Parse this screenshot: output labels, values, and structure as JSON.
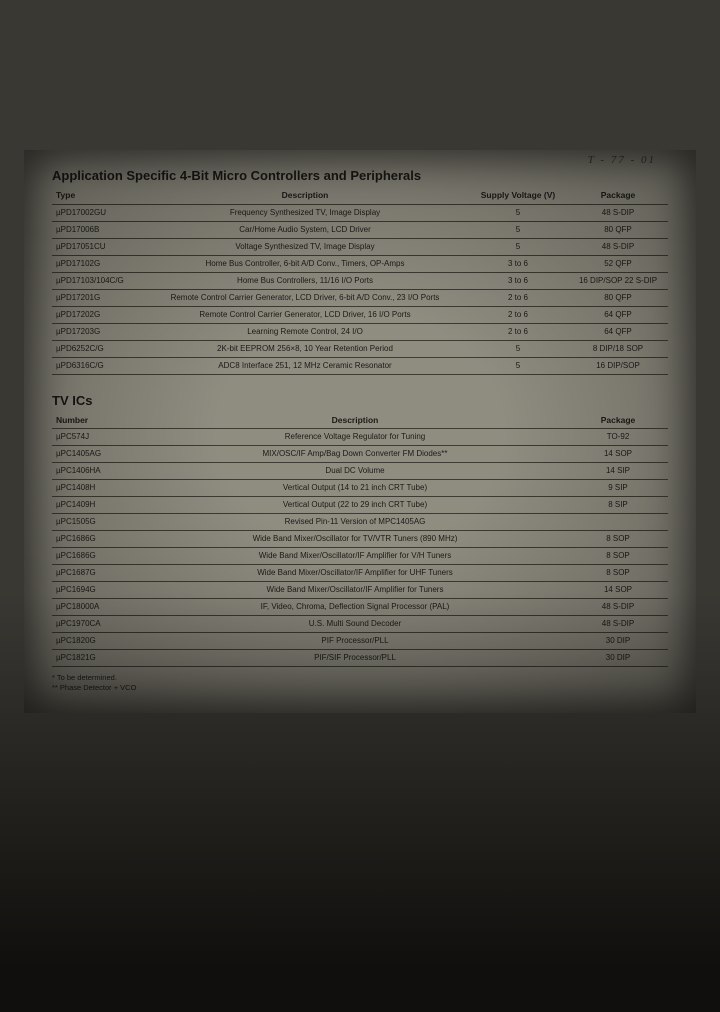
{
  "doc_code": "T - 77 - 01",
  "section1": {
    "title": "Application Specific 4-Bit Micro Controllers and Peripherals",
    "headers": {
      "type": "Type",
      "description": "Description",
      "voltage": "Supply Voltage (V)",
      "package": "Package"
    },
    "rows": [
      {
        "type": "µPD17002GU",
        "desc": "Frequency Synthesized TV, Image Display",
        "volt": "5",
        "pkg": "48 S-DIP"
      },
      {
        "type": "µPD17006B",
        "desc": "Car/Home Audio System, LCD Driver",
        "volt": "5",
        "pkg": "80 QFP"
      },
      {
        "type": "µPD17051CU",
        "desc": "Voltage Synthesized TV, Image Display",
        "volt": "5",
        "pkg": "48 S-DIP"
      },
      {
        "type": "µPD17102G",
        "desc": "Home Bus Controller, 6-bit A/D Conv., Timers, OP-Amps",
        "volt": "3 to 6",
        "pkg": "52 QFP"
      },
      {
        "type": "µPD17103/104C/G",
        "desc": "Home Bus Controllers, 11/16 I/O Ports",
        "volt": "3 to 6",
        "pkg": "16 DIP/SOP\n22 S-DIP"
      },
      {
        "type": "µPD17201G",
        "desc": "Remote Control Carrier Generator, LCD Driver, 6-bit A/D Conv., 23 I/O Ports",
        "volt": "2 to 6",
        "pkg": "80 QFP"
      },
      {
        "type": "µPD17202G",
        "desc": "Remote Control Carrier Generator, LCD Driver, 16 I/O Ports",
        "volt": "2 to 6",
        "pkg": "64 QFP"
      },
      {
        "type": "µPD17203G",
        "desc": "Learning Remote Control, 24 I/O",
        "volt": "2 to 6",
        "pkg": "64 QFP"
      },
      {
        "type": "µPD6252C/G",
        "desc": "2K-bit EEPROM 256×8, 10 Year Retention Period",
        "volt": "5",
        "pkg": "8 DIP/18 SOP"
      },
      {
        "type": "µPD6316C/G",
        "desc": "ADC8 Interface 251, 12 MHz Ceramic Resonator",
        "volt": "5",
        "pkg": "16 DIP/SOP"
      }
    ]
  },
  "section2": {
    "title": "TV ICs",
    "headers": {
      "number": "Number",
      "description": "Description",
      "package": "Package"
    },
    "rows": [
      {
        "num": "µPC574J",
        "desc": "Reference Voltage Regulator for Tuning",
        "pkg": "TO-92"
      },
      {
        "num": "µPC1405AG",
        "desc": "MIX/OSC/IF Amp/Bag Down Converter FM Diodes**",
        "pkg": "14 SOP"
      },
      {
        "num": "µPC1406HA",
        "desc": "Dual DC Volume",
        "pkg": "14 SIP"
      },
      {
        "num": "µPC1408H",
        "desc": "Vertical Output (14 to 21 inch CRT Tube)",
        "pkg": "9 SIP"
      },
      {
        "num": "µPC1409H",
        "desc": "Vertical Output (22 to 29 inch CRT Tube)",
        "pkg": "8 SIP"
      },
      {
        "num": "µPC1505G",
        "desc": "Revised Pin-11 Version of MPC1405AG",
        "pkg": ""
      },
      {
        "num": "µPC1686G",
        "desc": "Wide Band Mixer/Oscillator for TV/VTR Tuners (890 MHz)",
        "pkg": "8 SOP"
      },
      {
        "num": "µPC1686G",
        "desc": "Wide Band Mixer/Oscillator/IF Amplifier for V/H Tuners",
        "pkg": "8 SOP"
      },
      {
        "num": "µPC1687G",
        "desc": "Wide Band Mixer/Oscillator/IF Amplifier for UHF Tuners",
        "pkg": "8 SOP"
      },
      {
        "num": "µPC1694G",
        "desc": "Wide Band Mixer/Oscillator/IF Amplifier for Tuners",
        "pkg": "14 SOP"
      },
      {
        "num": "µPC18000A",
        "desc": "IF, Video, Chroma, Deflection Signal Processor (PAL)",
        "pkg": "48 S-DIP"
      },
      {
        "num": "µPC1970CA",
        "desc": "U.S. Multi Sound Decoder",
        "pkg": "48 S-DIP"
      },
      {
        "num": "µPC1820G",
        "desc": "PIF Processor/PLL",
        "pkg": "30 DIP"
      },
      {
        "num": "µPC1821G",
        "desc": "PIF/SIF Processor/PLL",
        "pkg": "30 DIP"
      }
    ]
  },
  "footnotes": {
    "a": "* To be determined.",
    "b": "** Phase Detector + VCO"
  }
}
